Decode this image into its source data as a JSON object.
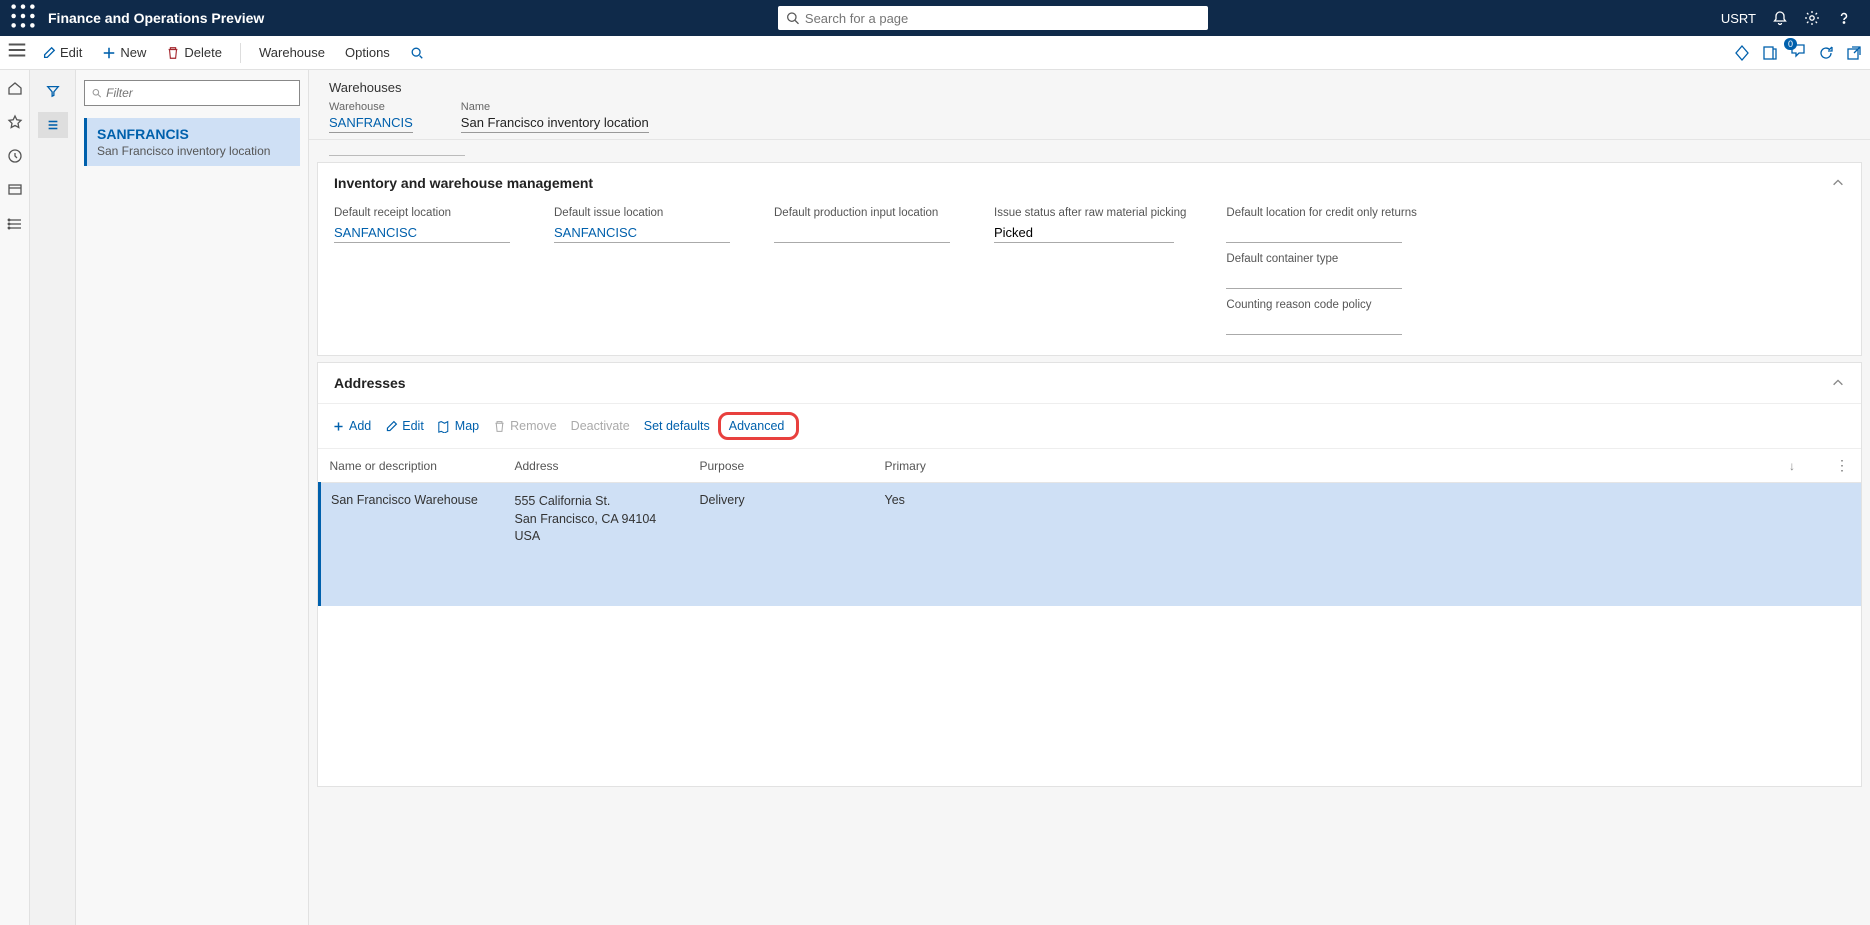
{
  "topbar": {
    "app_title": "Finance and Operations Preview",
    "search_placeholder": "Search for a page",
    "company": "USRT"
  },
  "actionbar": {
    "edit": "Edit",
    "new": "New",
    "delete": "Delete",
    "tab1": "Warehouse",
    "tab2": "Options",
    "notif_count": "0"
  },
  "listpanel": {
    "filter_placeholder": "Filter",
    "item_title": "SANFRANCIS",
    "item_sub": "San Francisco inventory location"
  },
  "header": {
    "breadcrumb": "Warehouses",
    "warehouse_label": "Warehouse",
    "warehouse_value": "SANFRANCIS",
    "name_label": "Name",
    "name_value": "San Francisco inventory location"
  },
  "card_inv": {
    "title": "Inventory and warehouse management",
    "fields": {
      "default_receipt_label": "Default receipt location",
      "default_receipt_value": "SANFANCISC",
      "default_issue_label": "Default issue location",
      "default_issue_value": "SANFANCISC",
      "default_prod_label": "Default production input location",
      "default_prod_value": "",
      "issue_status_label": "Issue status after raw material picking",
      "issue_status_value": "Picked",
      "default_credit_label": "Default location for credit only returns",
      "default_credit_value": "",
      "default_container_label": "Default container type",
      "default_container_value": "",
      "counting_label": "Counting reason code policy",
      "counting_value": ""
    }
  },
  "card_addr": {
    "title": "Addresses",
    "toolbar": {
      "add": "Add",
      "edit": "Edit",
      "map": "Map",
      "remove": "Remove",
      "deactivate": "Deactivate",
      "set_defaults": "Set defaults",
      "advanced": "Advanced"
    },
    "columns": {
      "name": "Name or description",
      "address": "Address",
      "purpose": "Purpose",
      "primary": "Primary"
    },
    "row": {
      "name": "San Francisco Warehouse",
      "address": "555 California St.\nSan Francisco, CA 94104\nUSA",
      "purpose": "Delivery",
      "primary": "Yes"
    }
  }
}
